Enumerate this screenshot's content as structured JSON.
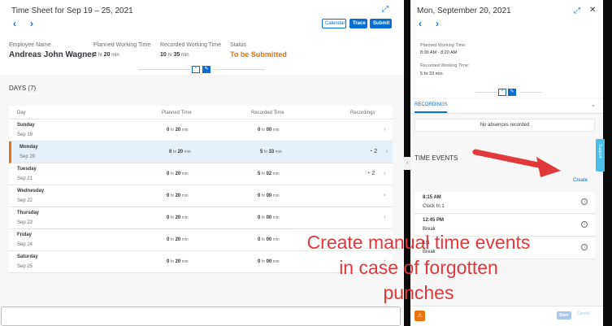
{
  "timesheet": {
    "title": "Time Sheet for Sep 19 – 25, 2021",
    "buttons": {
      "calendar": "Calendar",
      "trace": "Trace",
      "submit": "Submit"
    },
    "employee_label": "Employee Name",
    "employee_name": "Andreas John Wagner",
    "planned_label": "Planned Working Time",
    "planned_hr": "2",
    "planned_min": "20",
    "recorded_label": "Recorded Working Time",
    "recorded_hr": "10",
    "recorded_min": "35",
    "status_label": "Status",
    "status_value": "To be Submitted",
    "unit_hr": "hr",
    "unit_min": "min"
  },
  "days": {
    "title": "DAYS (7)",
    "headers": {
      "day": "Day",
      "planned": "Planned Time",
      "recorded": "Recorded Time",
      "recordings": "Recordings"
    },
    "rows": [
      {
        "day": "Sunday",
        "date": "Sep 19",
        "p_hr": "0",
        "p_min": "20",
        "r_hr": "0",
        "r_min": "00",
        "count": ""
      },
      {
        "day": "Monday",
        "date": "Sep 20",
        "p_hr": "0",
        "p_min": "20",
        "r_hr": "5",
        "r_min": "33",
        "count": "2"
      },
      {
        "day": "Tuesday",
        "date": "Sep 21",
        "p_hr": "0",
        "p_min": "20",
        "r_hr": "5",
        "r_min": "02",
        "count": "2"
      },
      {
        "day": "Wednesday",
        "date": "Sep 22",
        "p_hr": "0",
        "p_min": "20",
        "r_hr": "0",
        "r_min": "00",
        "count": ""
      },
      {
        "day": "Thursday",
        "date": "Sep 23",
        "p_hr": "0",
        "p_min": "20",
        "r_hr": "0",
        "r_min": "00",
        "count": ""
      },
      {
        "day": "Friday",
        "date": "Sep 24",
        "p_hr": "0",
        "p_min": "20",
        "r_hr": "0",
        "r_min": "00",
        "count": ""
      },
      {
        "day": "Saturday",
        "date": "Sep 25",
        "p_hr": "0",
        "p_min": "20",
        "r_hr": "0",
        "r_min": "00",
        "count": ""
      }
    ]
  },
  "detail": {
    "title": "Mon, September 20, 2021",
    "planned_label": "Planned Working Time:",
    "planned_value": "8:00 AM - 8:20 AM",
    "recorded_label": "Recorded Working Time:",
    "recorded_value": "5 hr 33 min",
    "tab": "RECORDINGS",
    "no_absences": "No absences recorded",
    "time_events_title": "TIME EVENTS",
    "create": "Create",
    "events": [
      {
        "time": "8:15 AM",
        "desc": "Clock In 1"
      },
      {
        "time": "12:45 PM",
        "desc": "Break"
      },
      {
        "time": "1:1",
        "desc": "Break"
      }
    ],
    "save": "Save",
    "cancel": "Cancel"
  },
  "support": "Support",
  "annotation": {
    "line1": "Create manual time events",
    "line2": "in case of forgotten",
    "line3": "punches",
    "color": "#e0383b"
  },
  "icons": [
    "chevron-left-icon",
    "chevron-right-icon",
    "expand-icon",
    "close-icon",
    "collapse-icon",
    "pin-icon",
    "clock-icon",
    "info-icon",
    "warning-icon"
  ]
}
